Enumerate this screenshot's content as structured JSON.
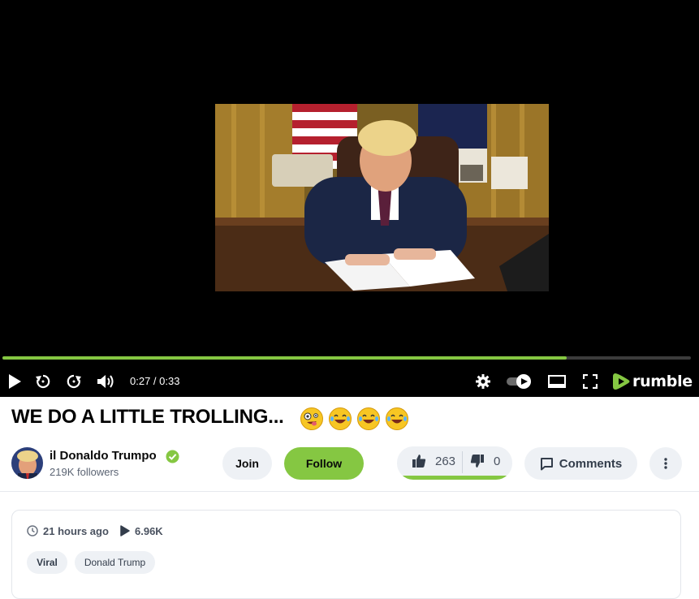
{
  "player": {
    "progress": 0.82,
    "time_current": "0:27",
    "time_total": "0:33",
    "time_display": "0:27 / 0:33",
    "brand": "rumble",
    "accent_color": "#85c742"
  },
  "video": {
    "title": "WE DO A LITTLE TROLLING...",
    "title_emojis": [
      "zany-face",
      "tears-of-joy",
      "tears-of-joy",
      "tears-of-joy"
    ],
    "posted": "21 hours ago",
    "views": "6.96K",
    "tags": [
      "Viral",
      "Donald Trump"
    ]
  },
  "channel": {
    "name": "il Donaldo Trumpo",
    "followers": "219K followers",
    "verified": true
  },
  "actions": {
    "join_label": "Join",
    "follow_label": "Follow",
    "upvotes": "263",
    "downvotes": "0",
    "vote_ratio": 1.0,
    "comments_label": "Comments"
  },
  "icons": {
    "play": "play-icon",
    "rewind": "rewind-icon",
    "forward": "forward-icon",
    "volume": "volume-icon",
    "settings": "gear-icon",
    "autoplay": "toggle-icon",
    "theater": "theater-icon",
    "fullscreen": "fullscreen-icon",
    "clock": "clock-icon",
    "views": "play-count-icon",
    "upvote": "thumbs-up-icon",
    "downvote": "thumbs-down-icon",
    "comments": "comment-icon",
    "more": "kebab-icon"
  }
}
